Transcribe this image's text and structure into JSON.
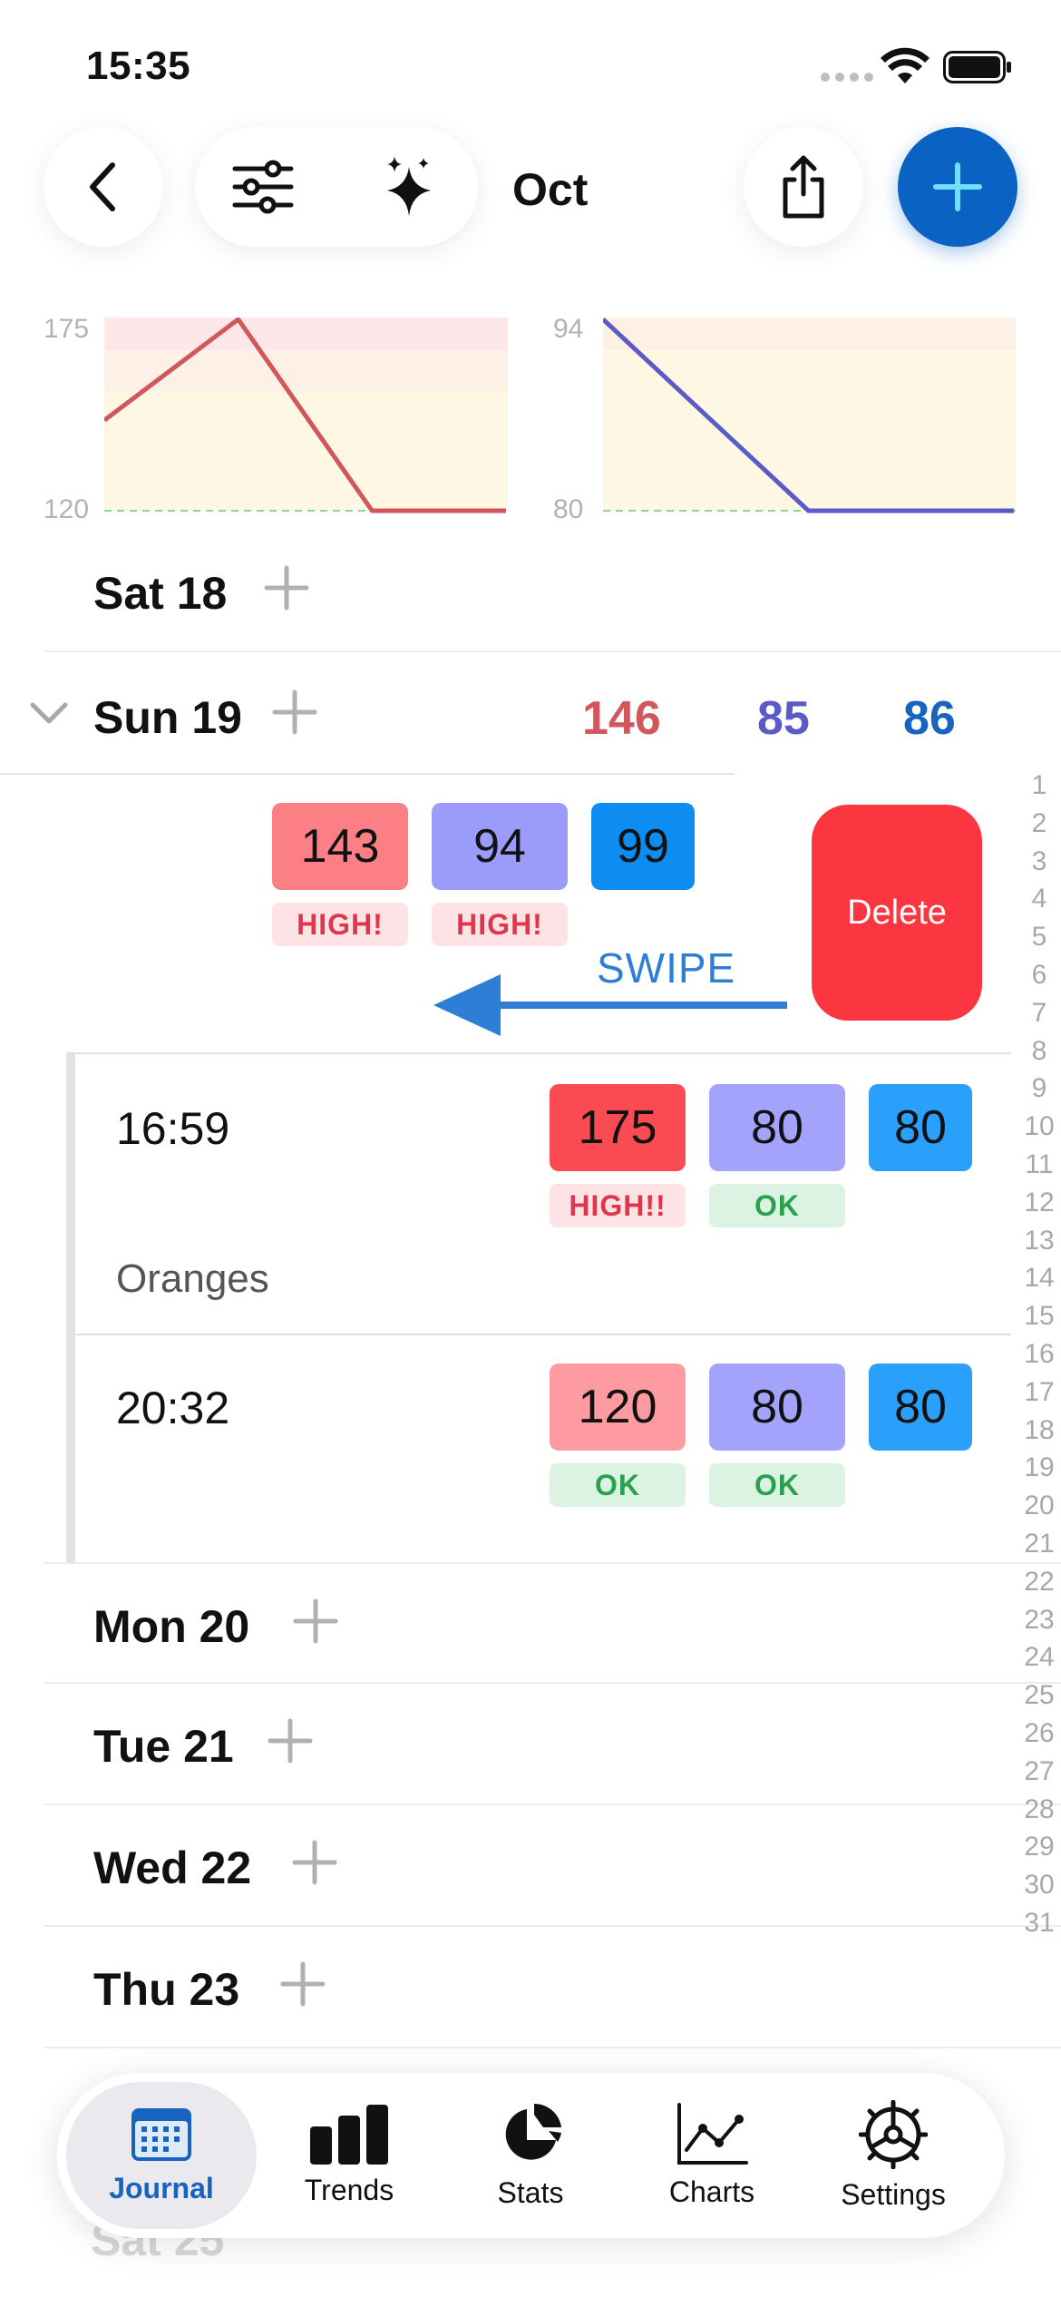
{
  "status_bar": {
    "time": "15:35"
  },
  "toolbar": {
    "month": "Oct"
  },
  "mini_charts": {
    "left": {
      "y_max_label": "175",
      "y_min_label": "120",
      "points": [
        146,
        175,
        120,
        120
      ],
      "color": "#d0575c"
    },
    "right": {
      "y_max_label": "94",
      "y_min_label": "80",
      "points": [
        94,
        80,
        80
      ],
      "color": "#5b5bc7"
    }
  },
  "days": {
    "sat18": {
      "label": "Sat 18"
    },
    "sun19": {
      "label": "Sun 19",
      "avg_systolic": "146",
      "avg_diastolic": "85",
      "avg_pulse": "86"
    },
    "mon20": {
      "label": "Mon 20"
    },
    "tue21": {
      "label": "Tue 21"
    },
    "wed22": {
      "label": "Wed 22"
    },
    "thu23": {
      "label": "Thu 23"
    },
    "sat25": {
      "label": "Sat 25"
    }
  },
  "swipe_entry": {
    "systolic": "143",
    "diastolic": "94",
    "pulse": "99",
    "systolic_status": "HIGH!",
    "diastolic_status": "HIGH!",
    "delete_label": "Delete",
    "swipe_label": "SWIPE"
  },
  "entries": [
    {
      "time": "16:59",
      "systolic": "175",
      "diastolic": "80",
      "pulse": "80",
      "systolic_status": "HIGH!!",
      "diastolic_status": "OK",
      "note": "Oranges"
    },
    {
      "time": "20:32",
      "systolic": "120",
      "diastolic": "80",
      "pulse": "80",
      "systolic_status": "OK",
      "diastolic_status": "OK"
    }
  ],
  "day_index": [
    "1",
    "2",
    "3",
    "4",
    "5",
    "6",
    "7",
    "8",
    "9",
    "10",
    "11",
    "12",
    "13",
    "14",
    "15",
    "16",
    "17",
    "18",
    "19",
    "20",
    "21",
    "22",
    "23",
    "24",
    "25",
    "26",
    "27",
    "28",
    "29",
    "30",
    "31"
  ],
  "tabs": {
    "journal": "Journal",
    "trends": "Trends",
    "stats": "Stats",
    "charts": "Charts",
    "settings": "Settings"
  },
  "colors": {
    "systolic": "#d0575c",
    "diastolic": "#5b5bc7",
    "pulse": "#1664bd",
    "accent": "#0a63c2",
    "delete": "#fb3640"
  }
}
